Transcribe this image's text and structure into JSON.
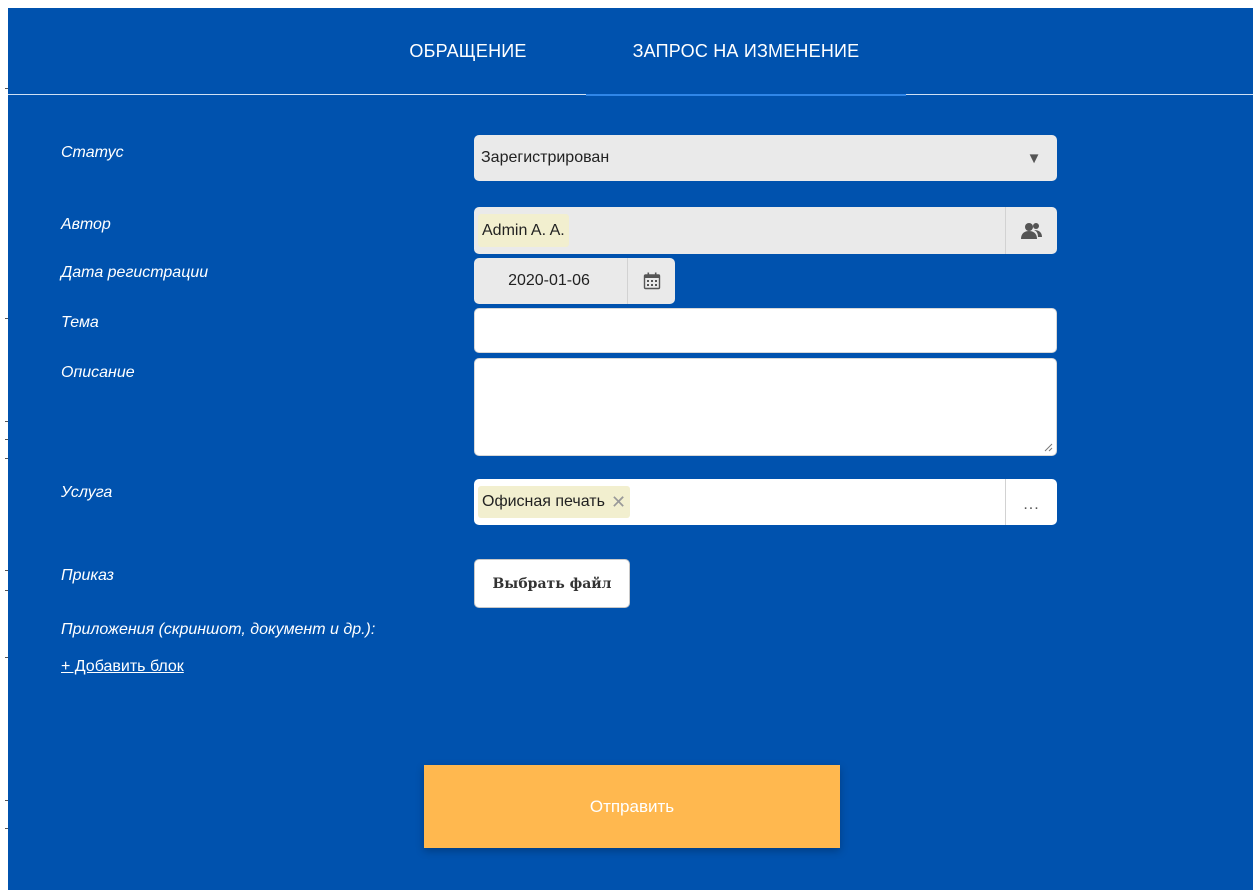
{
  "tabs": [
    {
      "label": "ОБРАЩЕНИЕ",
      "active": false
    },
    {
      "label": "ЗАПРОС НА ИЗМЕНЕНИЕ",
      "active": true
    }
  ],
  "form": {
    "status": {
      "label": "Статус",
      "value": "Зарегистрирован",
      "icon": "chevron-down-icon"
    },
    "author": {
      "label": "Автор",
      "value": "Admin A. A.",
      "icon": "user-group-icon"
    },
    "registration_date": {
      "label": "Дата регистрации",
      "value": "2020-01-06",
      "icon": "calendar-icon"
    },
    "subject": {
      "label": "Тема",
      "value": ""
    },
    "description": {
      "label": "Описание",
      "value": ""
    },
    "service": {
      "label": "Услуга",
      "value": "Офисная печать",
      "remove_glyph": "✕",
      "more_glyph": "..."
    },
    "order": {
      "label": "Приказ",
      "file_button": "Выбрать файл"
    },
    "attachments": {
      "label": "Приложения (скриншот, документ и др.):",
      "add_link": "+ Добавить блок"
    }
  },
  "submit_label": "Отправить",
  "colors": {
    "background": "#0052ae",
    "submit": "#ffb84f",
    "chip": "#f2efcf",
    "field_gray": "#eaeaea"
  }
}
